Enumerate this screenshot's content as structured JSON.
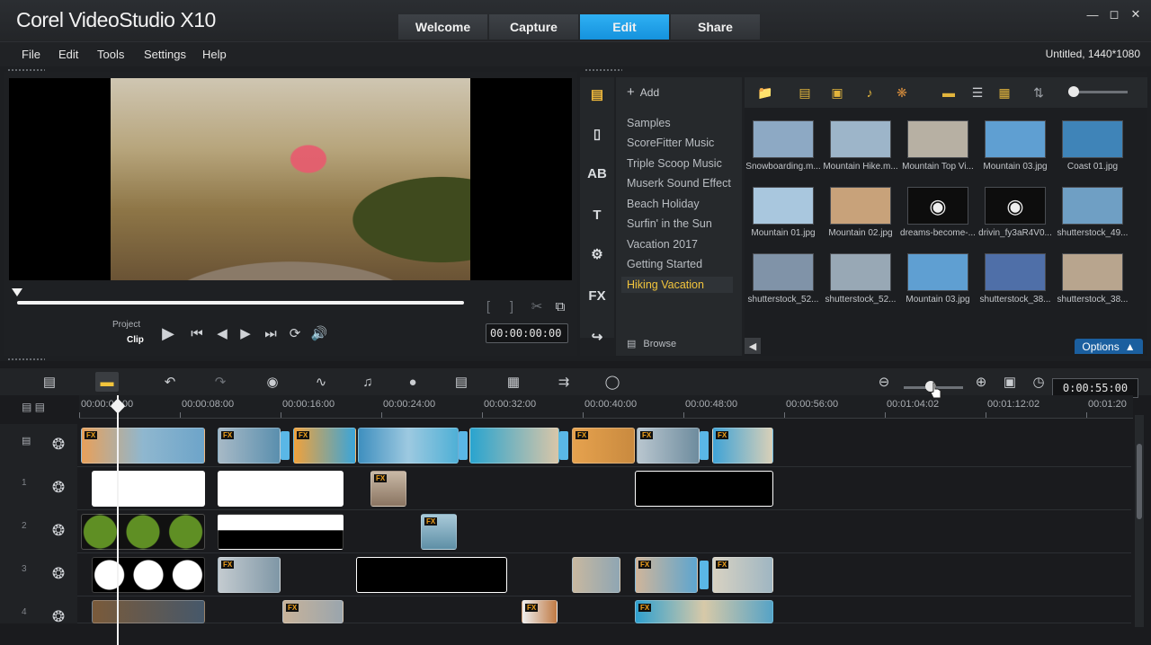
{
  "app": {
    "title": "Corel VideoStudio X10"
  },
  "tabs": [
    {
      "label": "Welcome"
    },
    {
      "label": "Capture"
    },
    {
      "label": "Edit"
    },
    {
      "label": "Share"
    }
  ],
  "menu": [
    {
      "label": "File"
    },
    {
      "label": "Edit"
    },
    {
      "label": "Tools"
    },
    {
      "label": "Settings"
    },
    {
      "label": "Help"
    }
  ],
  "project_info": "Untitled, 1440*1080",
  "player": {
    "mode_project": "Project",
    "mode_clip": "Clip",
    "timecode": "00:00:00:00",
    "buttons": [
      "play-icon",
      "home-icon",
      "prev-frame-icon",
      "next-frame-icon",
      "end-icon",
      "repeat-icon",
      "volume-icon"
    ]
  },
  "library": {
    "add_label": "Add",
    "browse_label": "Browse",
    "options_label": "Options",
    "sidebar_icons": [
      "media-icon",
      "instant-project-icon",
      "transition-icon",
      "title-icon",
      "graphic-icon",
      "filter-icon",
      "path-icon"
    ],
    "folders": [
      "Samples",
      "ScoreFitter Music",
      "Triple Scoop Music",
      "Muserk Sound Effect",
      "Beach Holiday",
      "Surfin' in the Sun",
      "Vacation 2017",
      "Getting Started",
      "Hiking Vacation"
    ],
    "selected_folder": "Hiking Vacation",
    "thumbnails": [
      {
        "caption": "Snowboarding.m...",
        "color": "#8da9c4"
      },
      {
        "caption": "Mountain Hike.m...",
        "color": "#9db5c9"
      },
      {
        "caption": "Mountain Top Vi...",
        "color": "#b7b0a3"
      },
      {
        "caption": "Mountain 03.jpg",
        "color": "#5f9fd2"
      },
      {
        "caption": "Coast 01.jpg",
        "color": "#3f84b8"
      },
      {
        "caption": "Mountain 01.jpg",
        "color": "#a9c7de"
      },
      {
        "caption": "Mountain 02.jpg",
        "color": "#c8a27a"
      },
      {
        "caption": "dreams-become-...",
        "color": "#0d0d0d"
      },
      {
        "caption": "drivin_fy3aR4V0...",
        "color": "#0d0d0d"
      },
      {
        "caption": "shutterstock_49...",
        "color": "#6f9fc4"
      },
      {
        "caption": "shutterstock_52...",
        "color": "#8093a8"
      },
      {
        "caption": "shutterstock_52...",
        "color": "#98a8b5"
      },
      {
        "caption": "Mountain 03.jpg",
        "color": "#5f9fd2"
      },
      {
        "caption": "shutterstock_38...",
        "color": "#4f6fa8"
      },
      {
        "caption": "shutterstock_38...",
        "color": "#b8a58e"
      }
    ]
  },
  "timeline": {
    "duration": "0:00:55:00",
    "ruler": [
      "00:00:00:00",
      "00:00:08:00",
      "00:00:16:00",
      "00:00:24:00",
      "00:00:32:00",
      "00:00:40:00",
      "00:00:48:00",
      "00:00:56:00",
      "00:01:04:02",
      "00:01:12:02",
      "00:01:20"
    ],
    "tracks": [
      "video",
      "overlay-1",
      "overlay-2",
      "overlay-3",
      "overlay-4"
    ],
    "track_numbers": [
      "",
      "1",
      "2",
      "3",
      "4"
    ],
    "clip_fx_label": "FX"
  }
}
